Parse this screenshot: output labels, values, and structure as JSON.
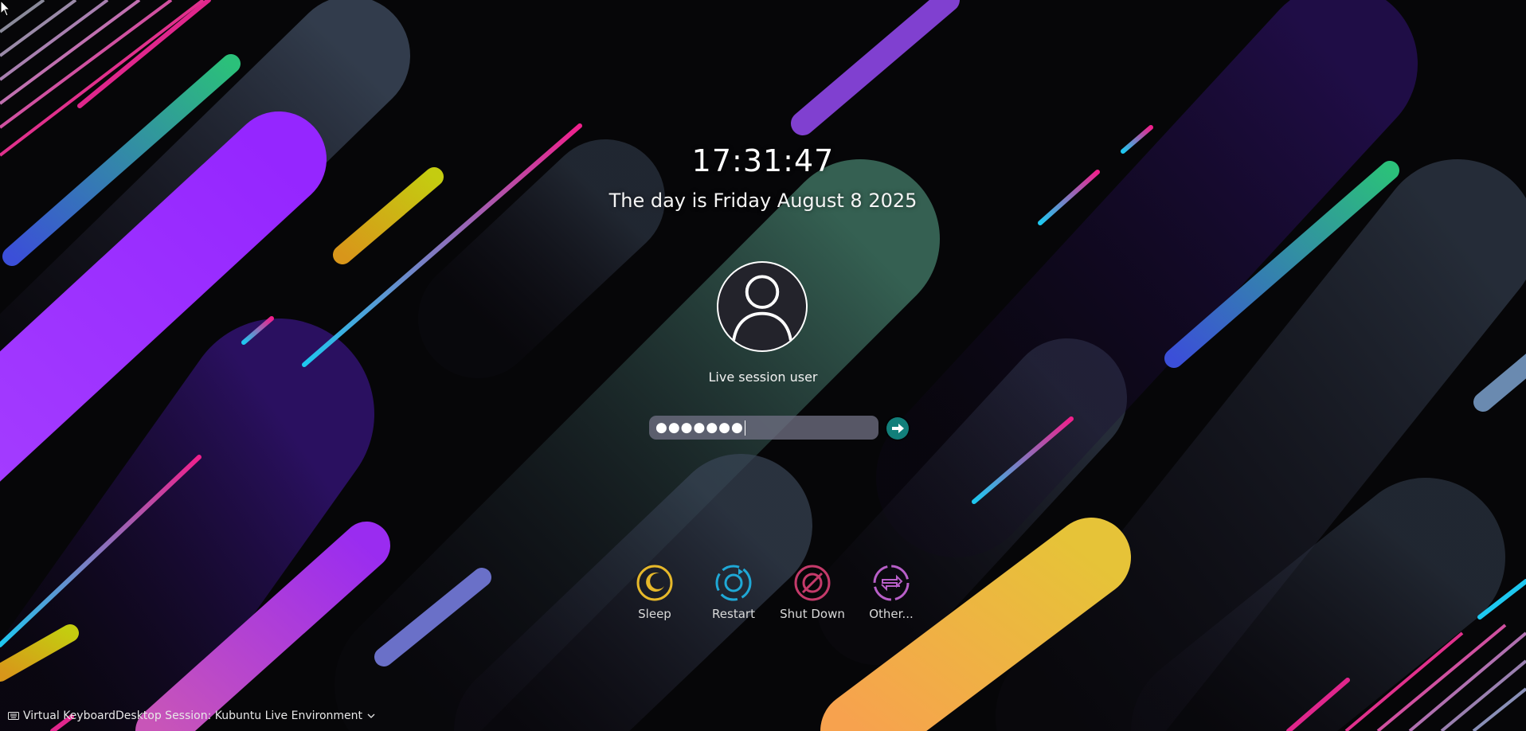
{
  "lockscreen": {
    "clock": "17:31:47",
    "date": "The day is Friday August 8 2025",
    "username": "Live session user",
    "password_value": "●●●●●●●",
    "accent": "#127f7a"
  },
  "actions": [
    {
      "label": "Sleep",
      "icon": "moon-icon",
      "color": "#e6b82a"
    },
    {
      "label": "Restart",
      "icon": "restart-icon",
      "color": "#1fa8d6"
    },
    {
      "label": "Shut Down",
      "icon": "power-icon",
      "color": "#c43a6a"
    },
    {
      "label": "Other...",
      "icon": "switch-user-icon",
      "color": "#b85fc8"
    }
  ],
  "bottom_bar": {
    "virtual_keyboard": "Virtual Keyboard",
    "desktop_session": "Desktop Session: Kubuntu Live Environment"
  }
}
